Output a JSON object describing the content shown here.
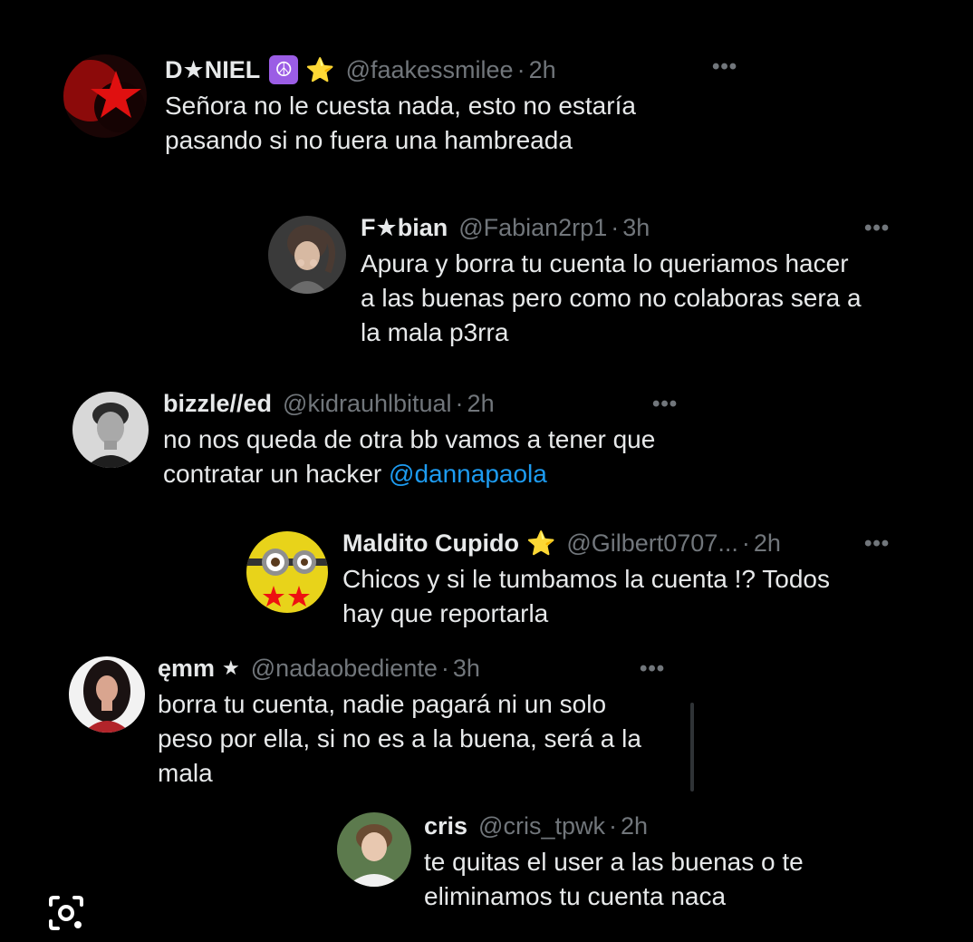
{
  "replies": [
    {
      "name": "D★NIEL",
      "badges": [
        "☮",
        "⭐"
      ],
      "handle": "@faakessmilee",
      "time": "2h",
      "text": "Señora no le cuesta nada, esto no estaría\npasando si no fuera una hambreada",
      "avatar": "red-star-avatar"
    },
    {
      "name": "F★bian",
      "handle": "@Fabian2rp1",
      "time": "3h",
      "text": "Apura y borra tu cuenta lo queriamos hacer\na las buenas pero como no colaboras sera a\nla mala p3rra",
      "avatar": "ponytail-girl-avatar"
    },
    {
      "name": "bizzle//ed",
      "handle": "@kidrauhlbitual",
      "time": "2h",
      "text": "no nos queda de otra bb vamos a tener que\ncontratar un hacker ",
      "mention": "@dannapaola",
      "avatar": "bw-man-avatar"
    },
    {
      "name": "Maldito Cupido",
      "badges": [
        "⭐"
      ],
      "handle": "@Gilbert0707...",
      "time": "2h",
      "text": "Chicos y si le tumbamos la cuenta !? Todos\nhay que reportarla",
      "avatar": "minion-avatar"
    },
    {
      "name": "ęmm",
      "badges": [
        "★"
      ],
      "handle": "@nadaobediente",
      "time": "3h",
      "text": "borra tu cuenta, nadie pagará ni un solo\npeso por ella, si no es a la buena, será a la\nmala",
      "avatar": "dark-hair-woman-avatar"
    },
    {
      "name": "cris",
      "handle": "@cris_tpwk",
      "time": "2h",
      "text": "te quitas el user a las buenas o te\neliminamos tu cuenta naca",
      "avatar": "young-man-avatar"
    }
  ],
  "more_label": "•••",
  "separator": "·"
}
